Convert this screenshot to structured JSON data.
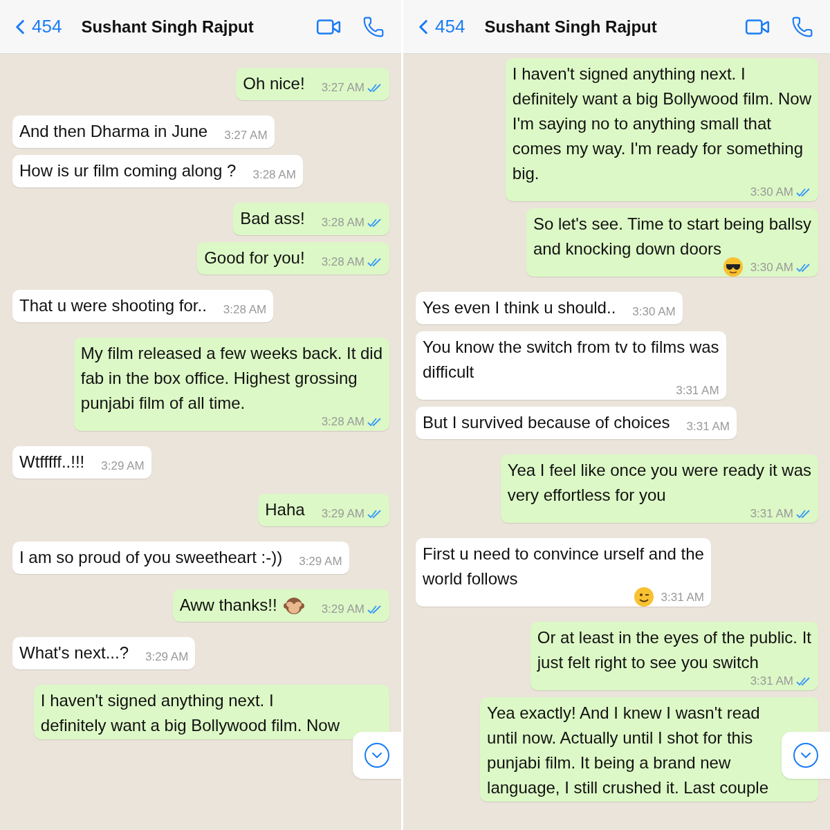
{
  "panels": [
    {
      "header": {
        "back_label": "454",
        "title": "Sushant Singh Rajput"
      },
      "messages": [
        {
          "kind": "sent",
          "lines": [
            "Oh nice!"
          ],
          "time": "3:27 AM",
          "read": true
        },
        {
          "kind": "received",
          "lines": [
            "And then Dharma in June"
          ],
          "time": "3:27 AM"
        },
        {
          "kind": "received",
          "lines": [
            "How is ur film coming along ?"
          ],
          "time": "3:28 AM"
        },
        {
          "kind": "sent",
          "lines": [
            "Bad ass!"
          ],
          "time": "3:28 AM",
          "read": true
        },
        {
          "kind": "sent",
          "lines": [
            "Good for you!"
          ],
          "time": "3:28 AM",
          "read": true
        },
        {
          "kind": "received",
          "lines": [
            "That u were shooting for.."
          ],
          "time": "3:28 AM"
        },
        {
          "kind": "sent",
          "lines": [
            "My film released a few weeks back. It did",
            "fab in the box office. Highest grossing",
            "punjabi film of all time."
          ],
          "time": "3:28 AM",
          "read": true
        },
        {
          "kind": "received",
          "lines": [
            "Wtfffff..!!!"
          ],
          "time": "3:29 AM"
        },
        {
          "kind": "sent",
          "lines": [
            "Haha"
          ],
          "time": "3:29 AM",
          "read": true
        },
        {
          "kind": "received",
          "lines": [
            "I am so proud of you sweetheart :-))"
          ],
          "time": "3:29 AM"
        },
        {
          "kind": "sent",
          "lines": [
            "Aww thanks!!"
          ],
          "emoji": {
            "kind": "monkey"
          },
          "time": "3:29 AM",
          "read": true
        },
        {
          "kind": "received",
          "lines": [
            "What's next...?"
          ],
          "time": "3:29 AM"
        },
        {
          "kind": "sent",
          "lines": [
            "I haven't signed anything next. I",
            "definitely want a big Bollywood film. Now"
          ]
        }
      ]
    },
    {
      "header": {
        "back_label": "454",
        "title": "Sushant Singh Rajput"
      },
      "messages": [
        {
          "kind": "sent",
          "lines": [
            "I haven't signed anything next. I",
            "definitely want a big Bollywood film. Now",
            "I'm saying no to anything small that",
            "comes my way. I'm ready for something",
            "big."
          ],
          "time": "3:30 AM",
          "read": true
        },
        {
          "kind": "sent",
          "lines": [
            "So let's see. Time to start being ballsy",
            "and knocking down doors"
          ],
          "emoji": {
            "kind": "sunglasses"
          },
          "time": "3:30 AM",
          "read": true
        },
        {
          "kind": "received",
          "lines": [
            "Yes even I think u should.."
          ],
          "time": "3:30 AM"
        },
        {
          "kind": "received",
          "lines": [
            "You know the switch from tv to films was",
            "difficult"
          ],
          "time": "3:31 AM"
        },
        {
          "kind": "received",
          "lines": [
            "But I survived because of choices"
          ],
          "time": "3:31 AM"
        },
        {
          "kind": "sent",
          "lines": [
            "Yea I feel like once you were ready it was",
            "very effortless for you"
          ],
          "time": "3:31 AM",
          "read": true
        },
        {
          "kind": "received",
          "lines": [
            "First u need to convince urself and the",
            "world follows"
          ],
          "emoji": {
            "kind": "wink"
          },
          "time": "3:31 AM"
        },
        {
          "kind": "sent",
          "lines": [
            "Or at least in the eyes of the public. It",
            "just felt right to see you switch"
          ],
          "time": "3:31 AM",
          "read": true
        },
        {
          "kind": "sent",
          "lines": [
            "Yea exactly! And I knew I wasn't read",
            "until now. Actually until I shot for this",
            "punjabi film. It being a brand new",
            "language, I still crushed it. Last couple"
          ]
        }
      ]
    }
  ]
}
